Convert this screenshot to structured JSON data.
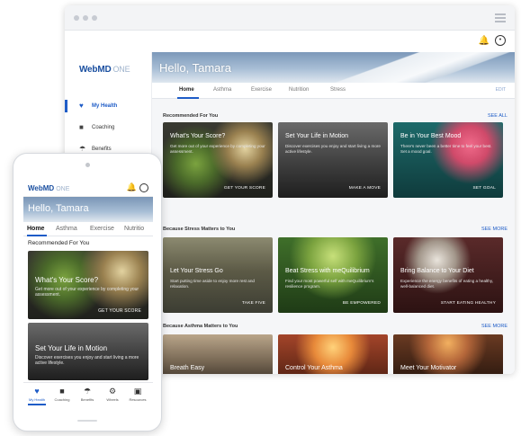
{
  "desktop": {
    "logo": {
      "brand": "WebMD",
      "product": "ONE"
    },
    "greeting": "Hello, Tamara",
    "sidebar": [
      {
        "label": "My Health",
        "icon": "heart-icon"
      },
      {
        "label": "Coaching",
        "icon": "chat-icon"
      },
      {
        "label": "Benefits",
        "icon": "umbrella-icon"
      }
    ],
    "tabs": [
      "Home",
      "Asthma",
      "Exercise",
      "Nutrition",
      "Stress"
    ],
    "tabs_edit": "EDIT",
    "sections": [
      {
        "title": "Recommended For You",
        "link": "SEE ALL",
        "cards": [
          {
            "title": "What's Your Score?",
            "desc": "Get more out of your experience by completing your assessment.",
            "cta": "GET YOUR SCORE"
          },
          {
            "title": "Set Your Life in Motion",
            "desc": "Discover exercises you enjoy and start living a more active lifestyle.",
            "cta": "MAKE A MOVE"
          },
          {
            "title": "Be in Your Best Mood",
            "desc": "There's never been a better time to feel your best. Set a mood goal.",
            "cta": "SET GOAL"
          }
        ]
      },
      {
        "title": "Because Stress Matters to You",
        "link": "SEE MORE",
        "cards": [
          {
            "title": "Let Your Stress Go",
            "desc": "Start putting time aside to enjoy more rest and relaxation.",
            "cta": "TAKE FIVE"
          },
          {
            "title": "Beat Stress with meQuilibrium",
            "desc": "Find your most powerful self with meQuilibrium's resilience program.",
            "cta": "BE EMPOWERED"
          },
          {
            "title": "Bring Balance to Your Diet",
            "desc": "Experience the energy benefits of eating a healthy, well-balanced diet.",
            "cta": "START EATING HEALTHY"
          }
        ]
      },
      {
        "title": "Because Asthma Matters to You",
        "link": "SEE MORE",
        "cards": [
          {
            "title": "Breath Easy"
          },
          {
            "title": "Control Your Asthma"
          },
          {
            "title": "Meet Your Motivator"
          }
        ]
      }
    ]
  },
  "phone": {
    "logo": {
      "brand": "WebMD",
      "product": "ONE"
    },
    "greeting": "Hello, Tamara",
    "tabs": [
      "Home",
      "Asthma",
      "Exercise",
      "Nutritio"
    ],
    "section_title": "Recommended For You",
    "cards": [
      {
        "title": "What's Your Score?",
        "desc": "Get more out of your experience by completing your assessment.",
        "cta": "GET YOUR SCORE"
      },
      {
        "title": "Set Your Life in Motion",
        "desc": "Discover exercises you enjoy and start living a more active lifestyle."
      }
    ],
    "nav": [
      {
        "label": "My Health",
        "icon": "heart-icon"
      },
      {
        "label": "Coaching",
        "icon": "chat-icon"
      },
      {
        "label": "Benefits",
        "icon": "umbrella-icon"
      },
      {
        "label": "Wheels",
        "icon": "gear-icon"
      },
      {
        "label": "Resources",
        "icon": "book-icon"
      }
    ]
  }
}
